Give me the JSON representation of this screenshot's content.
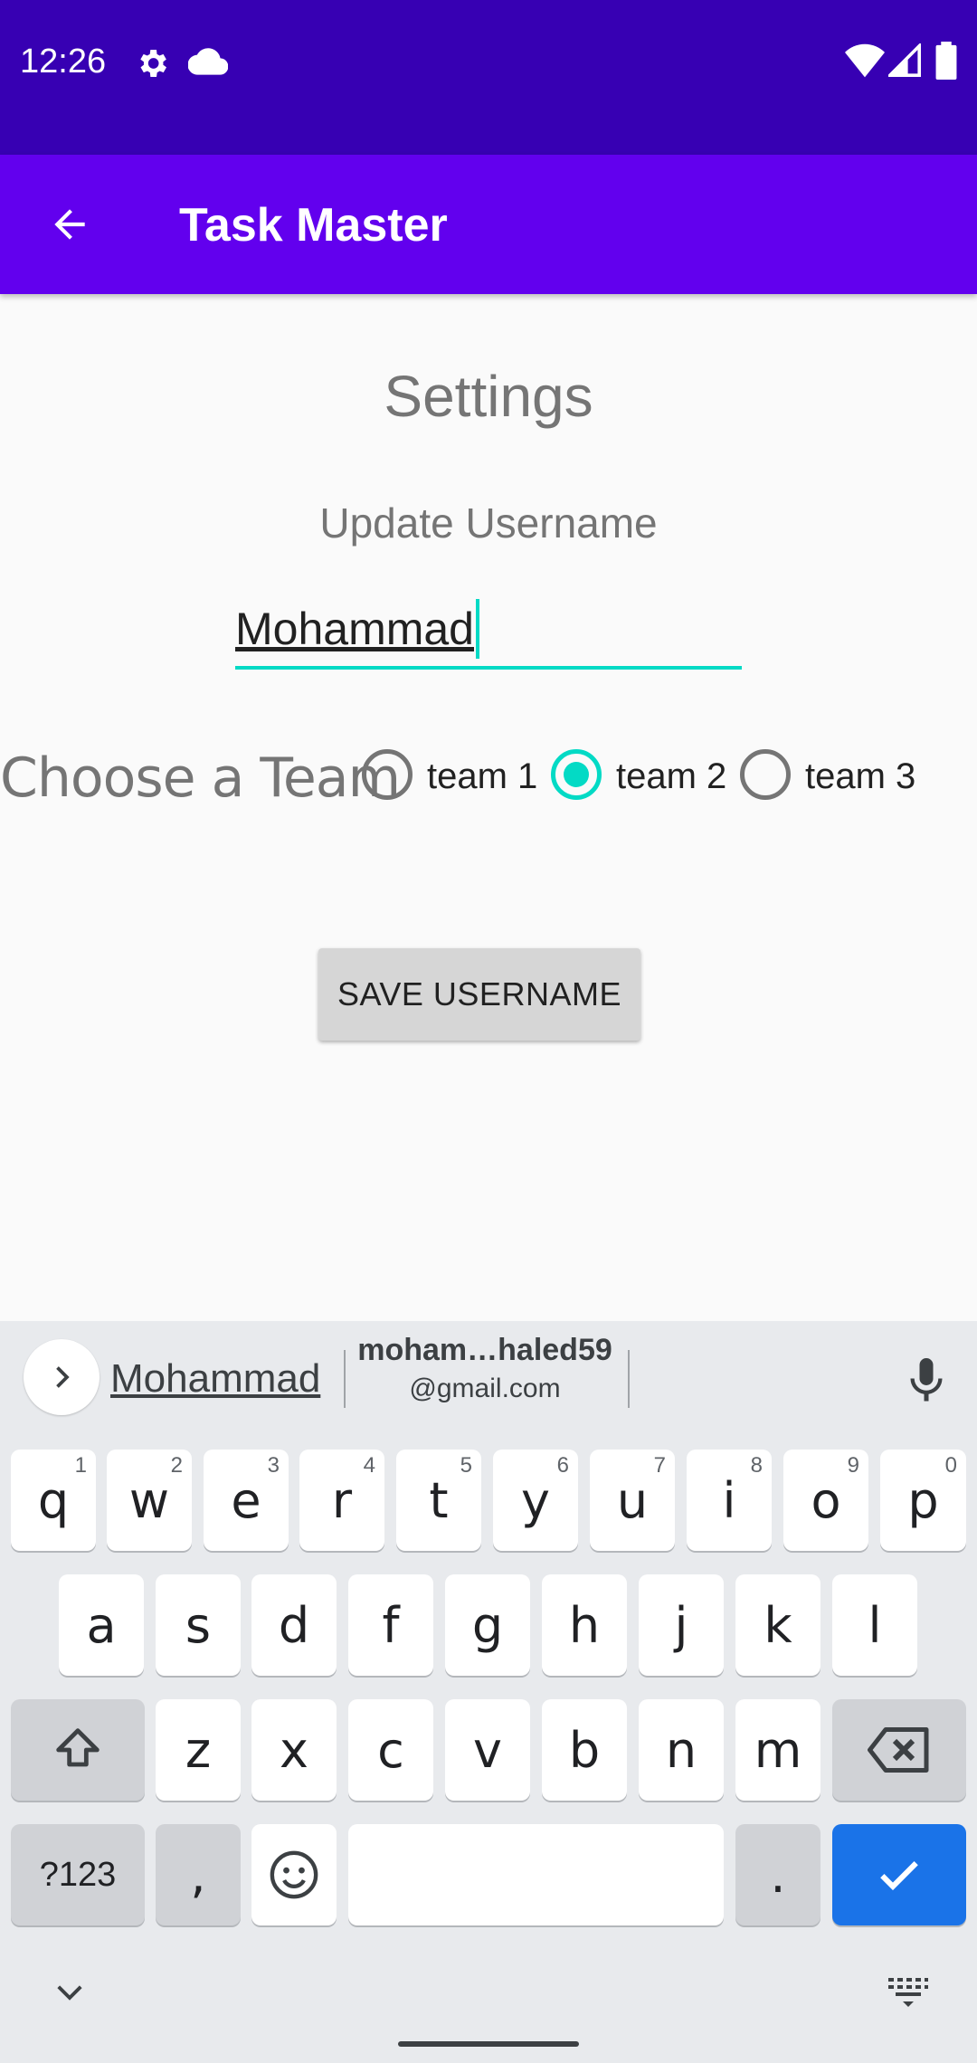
{
  "status_bar": {
    "time": "12:26",
    "icons": [
      "gear-icon",
      "cloud-icon",
      "wifi-icon",
      "signal-icon",
      "battery-icon"
    ]
  },
  "app_bar": {
    "title": "Task Master",
    "back_icon": "arrow-back-icon",
    "color": "#6200ee"
  },
  "main": {
    "page_title": "Settings",
    "update_label": "Update Username",
    "username_value": "Mohammad",
    "team_label": "Choose a Team",
    "teams": [
      {
        "label": "team 1",
        "selected": false
      },
      {
        "label": "team 2",
        "selected": true
      },
      {
        "label": "team 3",
        "selected": false
      }
    ],
    "save_button": "SAVE USERNAME",
    "accent_color": "#03dac5"
  },
  "keyboard": {
    "suggestions": {
      "first": "Mohammad",
      "second_line1": "moham…haled59",
      "second_line2": "@gmail.com"
    },
    "row1": [
      {
        "key": "q",
        "hint": "1"
      },
      {
        "key": "w",
        "hint": "2"
      },
      {
        "key": "e",
        "hint": "3"
      },
      {
        "key": "r",
        "hint": "4"
      },
      {
        "key": "t",
        "hint": "5"
      },
      {
        "key": "y",
        "hint": "6"
      },
      {
        "key": "u",
        "hint": "7"
      },
      {
        "key": "i",
        "hint": "8"
      },
      {
        "key": "o",
        "hint": "9"
      },
      {
        "key": "p",
        "hint": "0"
      }
    ],
    "row2": [
      "a",
      "s",
      "d",
      "f",
      "g",
      "h",
      "j",
      "k",
      "l"
    ],
    "row3": [
      "z",
      "x",
      "c",
      "v",
      "b",
      "n",
      "m"
    ],
    "symbols_key": "?123",
    "comma_key": ",",
    "period_key": ".",
    "action_color": "#1a73e8"
  }
}
